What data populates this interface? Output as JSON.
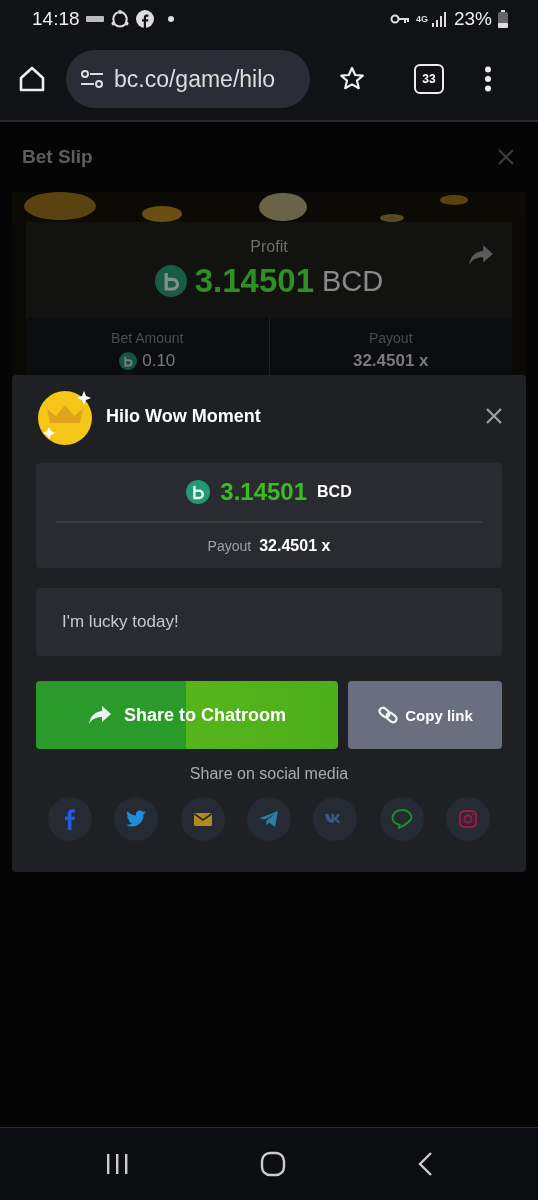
{
  "status_bar": {
    "time": "14:18",
    "network": "4G",
    "battery": "23%"
  },
  "browser": {
    "url": "bc.co/game/hilo",
    "tab_count": "33"
  },
  "bet_slip": {
    "title": "Bet Slip",
    "profit_label": "Profit",
    "profit_value": "3.14501",
    "currency": "BCD",
    "bet_amount_label": "Bet Amount",
    "bet_amount": "0.10",
    "payout_label": "Payout",
    "payout": "32.4501 x"
  },
  "modal": {
    "title": "Hilo Wow Moment",
    "amount": "3.14501",
    "currency": "BCD",
    "payout_label": "Payout",
    "payout": "32.4501 x",
    "message": "I'm lucky today!",
    "buttons": [
      {
        "label": "Share to Chatroom",
        "kind": "primary"
      },
      {
        "label": "Copy link",
        "kind": "secondary"
      }
    ],
    "social_label": "Share on social media",
    "social": [
      {
        "kind": "facebook",
        "color": "#1a5fe0"
      },
      {
        "kind": "twitter",
        "color": "#1d8fd8"
      },
      {
        "kind": "mail",
        "color": "#b38a1e"
      },
      {
        "kind": "telegram",
        "color": "#2a7fa8"
      },
      {
        "kind": "vk",
        "color": "#3a5580"
      },
      {
        "kind": "line",
        "color": "#1e8f2c"
      },
      {
        "kind": "instagram",
        "color": "#9a1a44"
      }
    ]
  }
}
